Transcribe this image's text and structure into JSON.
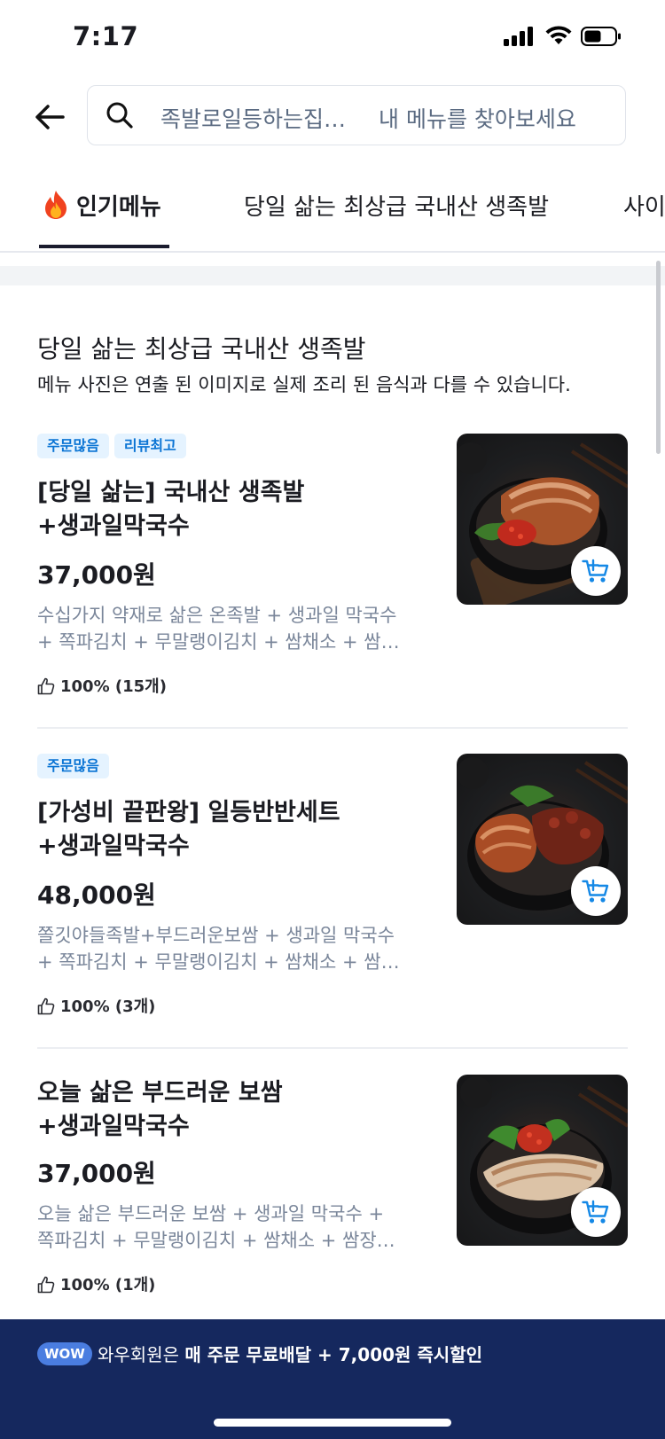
{
  "status_bar": {
    "time": "7:17"
  },
  "search": {
    "store_name": "족발로일등하는집…",
    "placeholder": "내 메뉴를 찾아보세요"
  },
  "tabs": [
    {
      "label": "인기메뉴",
      "icon": "fire-icon"
    },
    {
      "label": "당일 삶는 최상급 국내산 생족발"
    },
    {
      "label": "사이"
    }
  ],
  "section": {
    "title": "당일 삶는 최상급 국내산 생족발",
    "note": "메뉴 사진은 연출 된 이미지로 실제 조리 된 음식과 다를 수 있습니다."
  },
  "menu_items": [
    {
      "badges": [
        "주문많음",
        "리뷰최고"
      ],
      "name_line1": "[당일 삶는] 국내산 생족발",
      "name_line2": "+생과일막국수",
      "price": "37,000원",
      "desc_line1": "수십가지 약재로 삶은 온족발 + 생과일 막국수",
      "desc_line2": "+ 쪽파김치 + 무말랭이김치 + 쌈채소 + 쌈…",
      "rating": "100% (15개)"
    },
    {
      "badges": [
        "주문많음"
      ],
      "name_line1": "[가성비 끝판왕] 일등반반세트",
      "name_line2": "+생과일막국수",
      "price": "48,000원",
      "desc_line1": "쫄깃야들족발+부드러운보쌈 + 생과일 막국수",
      "desc_line2": "+ 쪽파김치 + 무말랭이김치 + 쌈채소 + 쌈…",
      "rating": "100% (3개)"
    },
    {
      "badges": [],
      "name_line1": "오늘 삶은 부드러운 보쌈",
      "name_line2": "+생과일막국수",
      "price": "37,000원",
      "desc_line1": "오늘 삶은 부드러운 보쌈 + 생과일 막국수 +",
      "desc_line2": "쪽파김치 + 무말랭이김치 + 쌈채소 + 쌈장…",
      "rating": "100% (1개)"
    }
  ],
  "wow_banner": {
    "badge": "WOW",
    "text_prefix": "와우회원은",
    "text_main": "매 주문 무료배달 + 7,000원 즉시할인"
  },
  "colors": {
    "accent_blue": "#0a74d4",
    "badge_bg": "#e5f3ff",
    "banner_bg": "#15285e",
    "wow_badge_bg": "#4a7de0"
  }
}
